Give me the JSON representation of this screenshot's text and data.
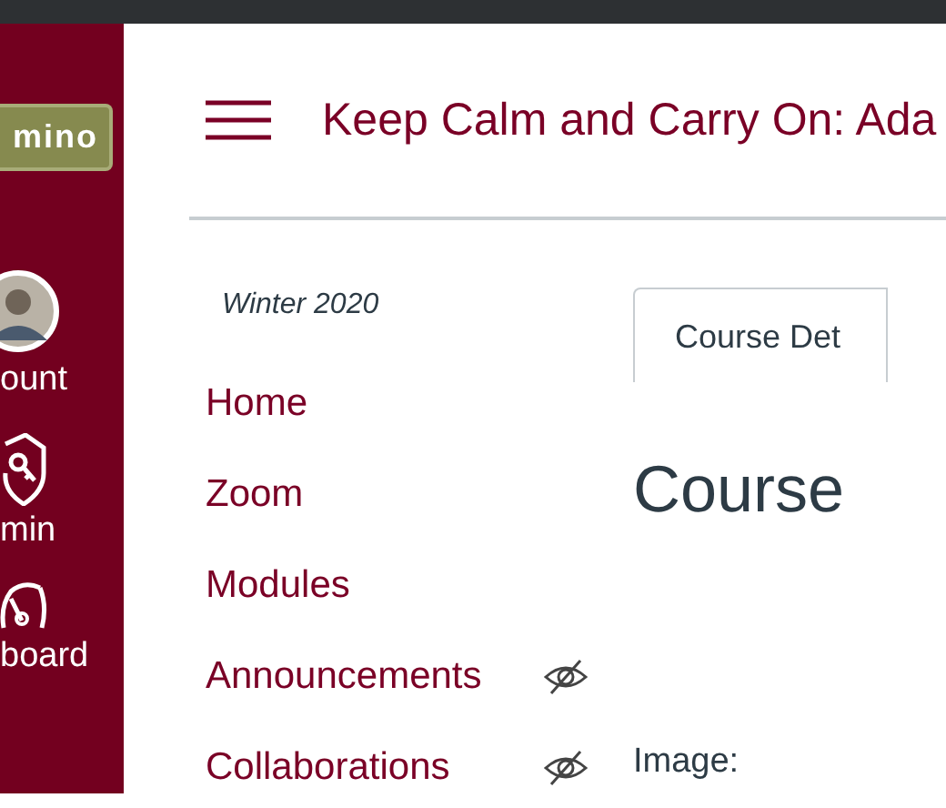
{
  "sidebar": {
    "logo": "mino",
    "items": [
      {
        "kind": "avatar",
        "label": "ount"
      },
      {
        "kind": "shield",
        "label": "min"
      },
      {
        "kind": "gauge",
        "label": "board"
      }
    ]
  },
  "header": {
    "title": "Keep Calm and Carry On: Ada"
  },
  "course_nav": {
    "term": "Winter 2020",
    "items": [
      {
        "label": "Home",
        "hidden": false
      },
      {
        "label": "Zoom",
        "hidden": false
      },
      {
        "label": "Modules",
        "hidden": false
      },
      {
        "label": "Announcements",
        "hidden": true
      },
      {
        "label": "Collaborations",
        "hidden": true
      }
    ]
  },
  "content": {
    "tabs": [
      {
        "label": "Course Det",
        "selected": true
      }
    ],
    "heading": "Course",
    "field_label": "Image:"
  }
}
